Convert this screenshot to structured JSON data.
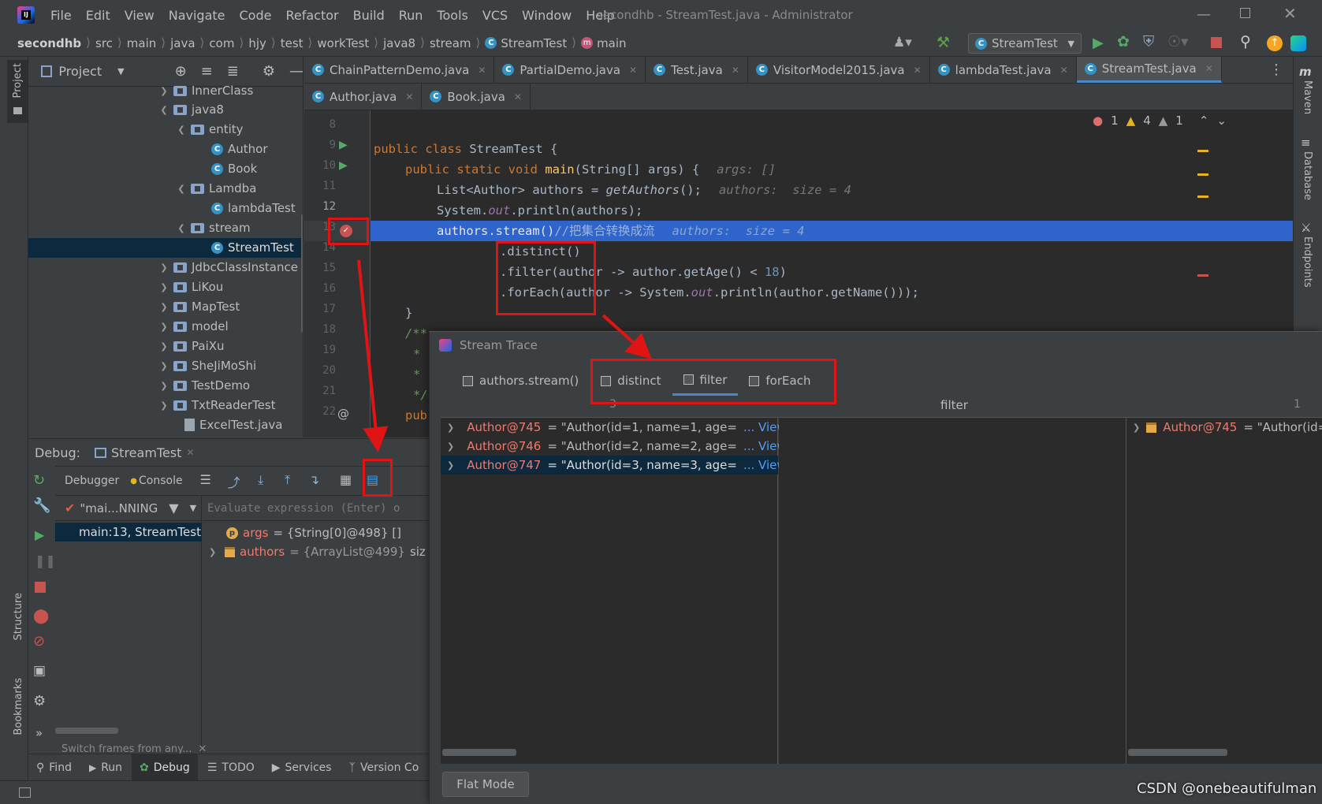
{
  "menu": {
    "items": [
      "File",
      "Edit",
      "View",
      "Navigate",
      "Code",
      "Refactor",
      "Build",
      "Run",
      "Tools",
      "VCS",
      "Window",
      "Help"
    ],
    "window_title": "secondhb - StreamTest.java - Administrator"
  },
  "breadcrumb": {
    "items": [
      "secondhb",
      "src",
      "main",
      "java",
      "com",
      "hjy",
      "test",
      "workTest",
      "java8",
      "stream",
      "StreamTest",
      "main"
    ]
  },
  "toolbar": {
    "run_config": "StreamTest"
  },
  "project_panel": {
    "title": "Project",
    "side_label": "Project",
    "tree": [
      {
        "label": "InnerClass",
        "kind": "folder",
        "expanded": false
      },
      {
        "label": "java8",
        "kind": "folder",
        "expanded": true
      },
      {
        "label": "entity",
        "kind": "folder",
        "expanded": true
      },
      {
        "label": "Author",
        "kind": "class"
      },
      {
        "label": "Book",
        "kind": "class"
      },
      {
        "label": "Lamdba",
        "kind": "folder",
        "expanded": true
      },
      {
        "label": "lambdaTest",
        "kind": "class"
      },
      {
        "label": "stream",
        "kind": "folder",
        "expanded": true
      },
      {
        "label": "StreamTest",
        "kind": "class",
        "selected": true
      },
      {
        "label": "JdbcClassInstance",
        "kind": "folder",
        "expanded": false
      },
      {
        "label": "LiKou",
        "kind": "folder",
        "expanded": false
      },
      {
        "label": "MapTest",
        "kind": "folder",
        "expanded": false
      },
      {
        "label": "model",
        "kind": "folder",
        "expanded": false
      },
      {
        "label": "PaiXu",
        "kind": "folder",
        "expanded": false
      },
      {
        "label": "SheJiMoShi",
        "kind": "folder",
        "expanded": false
      },
      {
        "label": "TestDemo",
        "kind": "folder",
        "expanded": false
      },
      {
        "label": "TxtReaderTest",
        "kind": "folder",
        "expanded": false
      },
      {
        "label": "ExcelTest.java",
        "kind": "file"
      }
    ]
  },
  "editor_tabs": {
    "row1": [
      "ChainPatternDemo.java",
      "PartialDemo.java",
      "Test.java",
      "VisitorModel2015.java",
      "lambdaTest.java",
      "StreamTest.java"
    ],
    "row2": [
      "Author.java",
      "Book.java"
    ],
    "active": "StreamTest.java"
  },
  "inspections": {
    "errors": "1",
    "warnings": "4",
    "weak": "1"
  },
  "code": {
    "line_numbers": [
      "8",
      "9",
      "10",
      "11",
      "12",
      "13",
      "14",
      "15",
      "16",
      "17",
      "18",
      "19",
      "20",
      "21",
      "22"
    ],
    "l9_kw": "public class ",
    "l9_name": "StreamTest",
    "l9_rest": " {",
    "l10_kw": "public static void ",
    "l10_fn": "main",
    "l10_rest": "(String[] args) {",
    "l10_hint": "args: []",
    "l11_a": "List<Author> authors = ",
    "l11_fn": "getAuthors",
    "l11_b": "();",
    "l11_hint": "authors:  size = 4",
    "l12_a": "System.",
    "l12_field": "out",
    "l12_b": ".println(authors);",
    "l13_a": "authors.stream()",
    "l13_cmt": "//把集合转换成流",
    "l13_hint": "authors:  size = 4",
    "l14": ".distinct()",
    "l15_a": ".filter(author -> author.getAge() < ",
    "l15_num": "18",
    "l15_b": ")",
    "l16_a": ".forEach(author -> System.",
    "l16_field": "out",
    "l16_b": ".println(author.getName()));",
    "l17": "}",
    "l18": "/**",
    "l19": "*",
    "l20": "*",
    "l21": "*/",
    "l22": "pub"
  },
  "debug": {
    "label": "Debug:",
    "session_tab": "StreamTest",
    "debugger_tab": "Debugger",
    "console_tab": "Console",
    "thread": "\"mai...NNING",
    "frame": "main:13, StreamTest (c",
    "evaluate_placeholder": "Evaluate expression (Enter) o",
    "vars": [
      {
        "badge": "p",
        "name": "args",
        "value": "= {String[0]@498} []"
      },
      {
        "badge": "obj",
        "name": "authors",
        "value": "= {ArrayList@499}",
        "extra": "siz"
      }
    ],
    "switch_frames": "Switch frames from any..."
  },
  "stream_trace": {
    "title": "Stream Trace",
    "tabs": [
      "authors.stream()",
      "distinct",
      "filter",
      "forEach"
    ],
    "active_tab": "filter",
    "column_title": "filter",
    "left_count": "3",
    "right_count": "1",
    "left_rows": [
      {
        "name": "Author@745",
        "value": "= \"Author(id=1, name=1, age=",
        "link": "... View"
      },
      {
        "name": "Author@746",
        "value": "= \"Author(id=2, name=2, age=",
        "link": "... View"
      },
      {
        "name": "Author@747",
        "value": "= \"Author(id=3, name=3, age=",
        "link": "... View"
      }
    ],
    "right_rows": [
      {
        "name": "Author@745",
        "value": "= \"Author(id="
      }
    ],
    "flat_mode": "Flat Mode"
  },
  "bottom_bar": {
    "items": [
      "Find",
      "Run",
      "Debug",
      "TODO",
      "Services",
      "Version Co"
    ]
  },
  "side_labels": {
    "structure": "Structure",
    "bookmarks": "Bookmarks",
    "maven": "Maven",
    "database": "Database",
    "endpoints": "Endpoints"
  },
  "watermark": "CSDN @onebeautifulman",
  "colors": {
    "selection": "#2f65ca",
    "annotation_red": "#e01414",
    "object_name": "#f07a6b",
    "link": "#589df6"
  }
}
